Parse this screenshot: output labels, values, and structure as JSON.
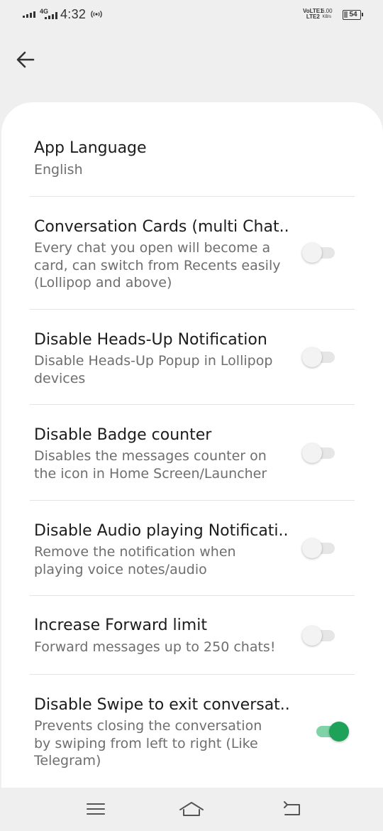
{
  "status_bar": {
    "network_type": "4G",
    "time": "4:32",
    "volte_line1": "VoLTE1",
    "volte_line2": "LTE2",
    "speed_value": "6.00",
    "speed_unit": "KB/s",
    "battery": "54"
  },
  "settings": [
    {
      "title": "App Language",
      "subtitle": "English"
    },
    {
      "title": "Conversation Cards (multi Chat..",
      "subtitle": "Every chat you open will become a card, can switch from Recents easily (Lollipop and above)",
      "enabled": false
    },
    {
      "title": "Disable Heads-Up Notification",
      "subtitle": "Disable Heads-Up Popup in Lollipop devices",
      "enabled": false
    },
    {
      "title": "Disable Badge counter",
      "subtitle": "Disables the messages counter on the icon in Home Screen/Launcher",
      "enabled": false
    },
    {
      "title": "Disable Audio playing Notificati..",
      "subtitle": "Remove the notification when playing voice notes/audio",
      "enabled": false
    },
    {
      "title": "Increase Forward limit",
      "subtitle": "Forward messages up to 250 chats!",
      "enabled": false
    },
    {
      "title": "Disable Swipe to exit conversat..",
      "subtitle": "Prevents closing the conversation by swiping from left to right (Like Telegram)",
      "enabled": true
    }
  ],
  "colors": {
    "toggle_on": "#1ea25a",
    "toggle_off": "#f3f3f3",
    "background": "#efefef",
    "card": "#ffffff"
  },
  "icons": {
    "back": "back-arrow-icon",
    "menu": "menu-icon",
    "home": "home-icon",
    "return": "return-icon"
  }
}
